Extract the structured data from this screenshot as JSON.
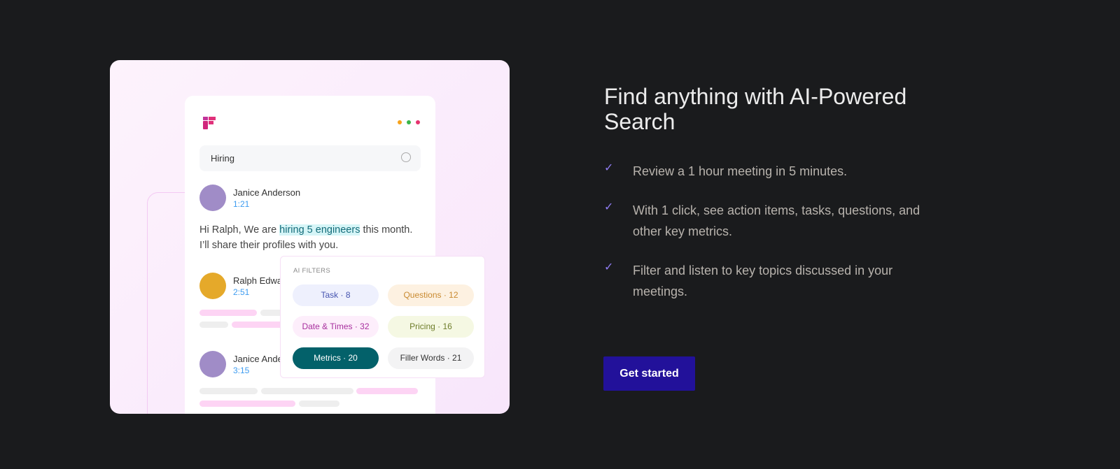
{
  "illustration": {
    "search_value": "Hiring",
    "messages": [
      {
        "name": "Janice Anderson",
        "time": "1:21",
        "text_before": "Hi Ralph, We are ",
        "highlight": "hiring 5 engineers",
        "text_after": " this month. I’ll share their profiles with you."
      },
      {
        "name": "Ralph Edwa",
        "time": "2:51"
      },
      {
        "name": "Janice Ande",
        "time": "3:15"
      }
    ],
    "filters_title": "AI FILTERS",
    "filters": [
      {
        "label": "Task · 8",
        "bg": "#eef0fd",
        "color": "#4654b0"
      },
      {
        "label": "Questions · 12",
        "bg": "#fdf1e1",
        "color": "#c98a30"
      },
      {
        "label": "Date & Times · 32",
        "bg": "#fdeefb",
        "color": "#a8309e"
      },
      {
        "label": "Pricing · 16",
        "bg": "#f5f8e3",
        "color": "#6e7d2a"
      },
      {
        "label": "Metrics · 20",
        "bg": "#03616a",
        "color": "#ffffff"
      },
      {
        "label": "Filler Words · 21",
        "bg": "#f3f3f4",
        "color": "#333333"
      }
    ]
  },
  "heading": "Find anything with AI-Powered Search",
  "features": [
    "Review a 1 hour meeting in 5 minutes.",
    "With 1 click, see action items, tasks, questions, and other key metrics.",
    "Filter and listen to key topics discussed in your meetings."
  ],
  "cta": "Get started",
  "colors": {
    "background": "#1a1b1d",
    "accent": "#22119a",
    "check": "#8f7cf2"
  }
}
